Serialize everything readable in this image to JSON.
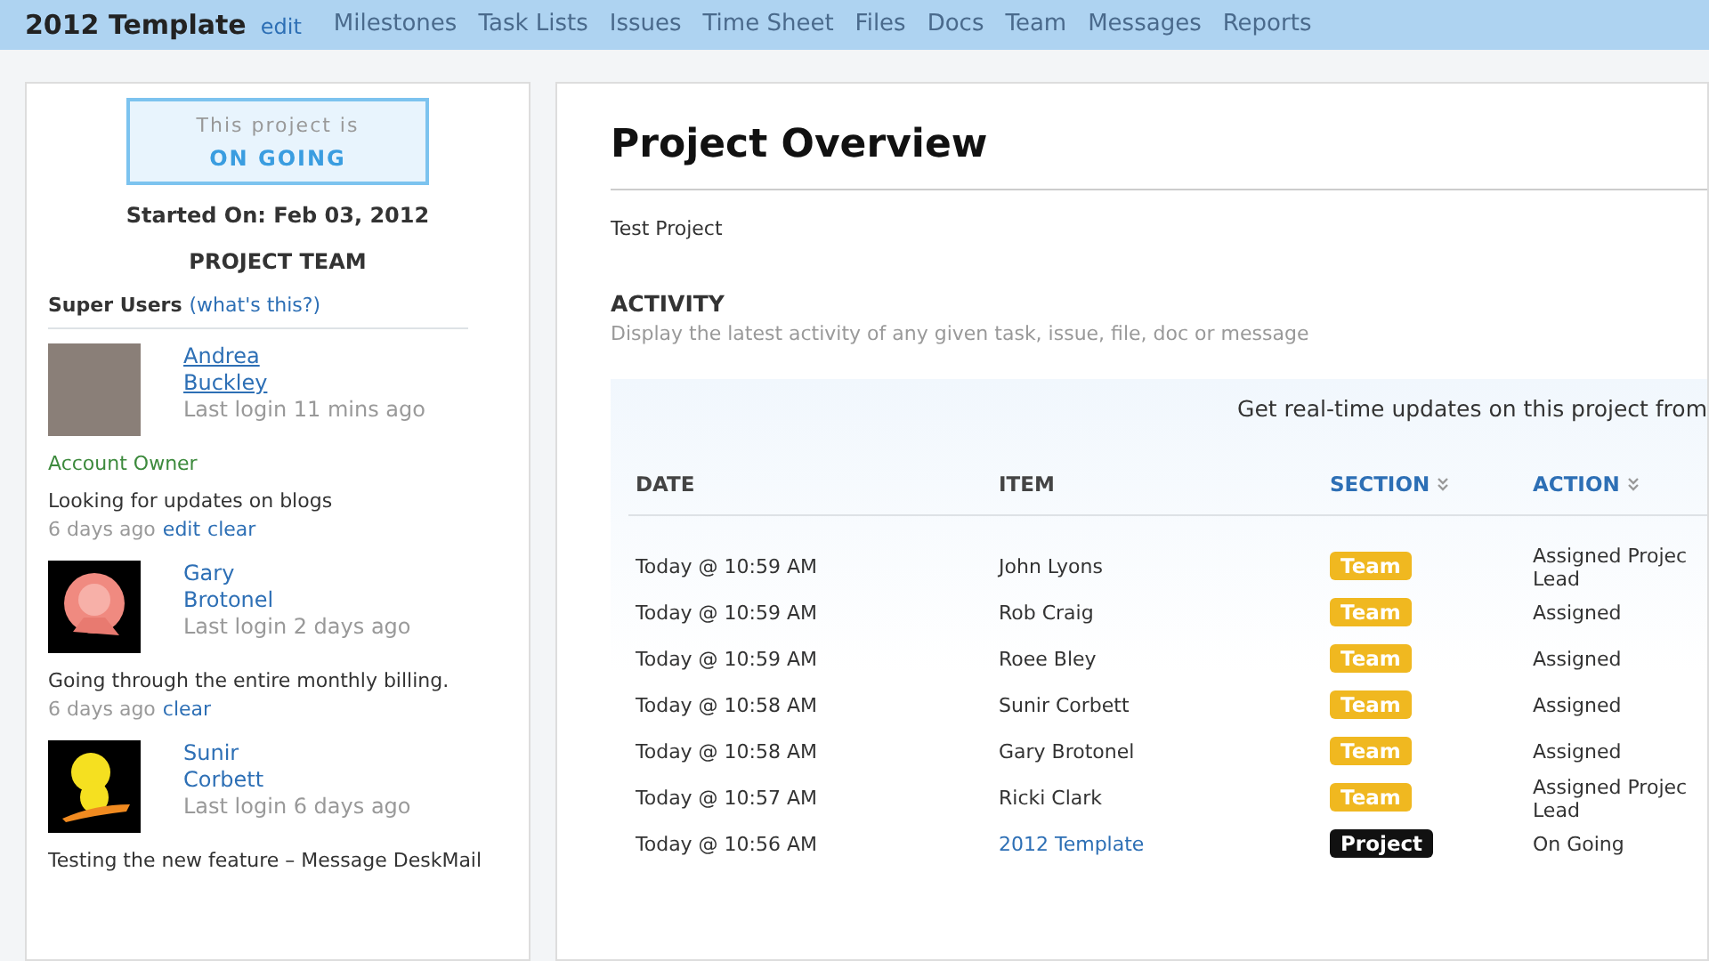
{
  "nav": {
    "title": "2012 Template",
    "edit": "edit",
    "items": [
      "Milestones",
      "Task Lists",
      "Issues",
      "Time Sheet",
      "Files",
      "Docs",
      "Team",
      "Messages",
      "Reports"
    ]
  },
  "sidebar": {
    "status_label": "This project is",
    "status": "ON GOING",
    "started": "Started On: Feb 03, 2012",
    "team_heading": "PROJECT TEAM",
    "super_users": "Super Users",
    "whats_this": "(what's this?)",
    "users": [
      {
        "first": "Andrea",
        "last": "Buckley",
        "login": "Last login 11 mins ago",
        "linked": true,
        "kind": "photo",
        "role": "Account Owner",
        "message": "Looking for updates on blogs",
        "age": "6 days ago",
        "links": [
          "edit",
          "clear"
        ]
      },
      {
        "first": "Gary",
        "last": "Brotonel",
        "login": "Last login 2 days ago",
        "linked": false,
        "kind": "rose",
        "message": "Going through the entire monthly billing.",
        "age": "6 days ago",
        "links": [
          "clear"
        ]
      },
      {
        "first": "Sunir",
        "last": "Corbett",
        "login": "Last login 6 days ago",
        "linked": false,
        "kind": "bird",
        "message": "Testing the new feature – Message DeskMail"
      }
    ]
  },
  "main": {
    "title": "Project Overview",
    "description": "Test Project",
    "activity_heading": "ACTIVITY",
    "activity_hint": "Display the latest activity of any given task, issue, file, doc or message",
    "banner": "Get real-time updates on this project from",
    "columns": [
      {
        "label": "DATE",
        "sortable": false
      },
      {
        "label": "ITEM",
        "sortable": false
      },
      {
        "label": "SECTION",
        "sortable": true
      },
      {
        "label": "ACTION",
        "sortable": true
      }
    ],
    "rows": [
      {
        "date": "Today @ 10:59 AM",
        "item": "John Lyons",
        "link": false,
        "section": "Team",
        "kind": "team",
        "action": "Assigned Projec Lead"
      },
      {
        "date": "Today @ 10:59 AM",
        "item": "Rob Craig",
        "link": false,
        "section": "Team",
        "kind": "team",
        "action": "Assigned"
      },
      {
        "date": "Today @ 10:59 AM",
        "item": "Roee Bley",
        "link": false,
        "section": "Team",
        "kind": "team",
        "action": "Assigned"
      },
      {
        "date": "Today @ 10:58 AM",
        "item": "Sunir Corbett",
        "link": false,
        "section": "Team",
        "kind": "team",
        "action": "Assigned"
      },
      {
        "date": "Today @ 10:58 AM",
        "item": "Gary Brotonel",
        "link": false,
        "section": "Team",
        "kind": "team",
        "action": "Assigned"
      },
      {
        "date": "Today @ 10:57 AM",
        "item": "Ricki Clark",
        "link": false,
        "section": "Team",
        "kind": "team",
        "action": "Assigned Projec Lead"
      },
      {
        "date": "Today @ 10:56 AM",
        "item": "2012 Template",
        "link": true,
        "section": "Project",
        "kind": "project",
        "action": "On Going"
      }
    ]
  }
}
